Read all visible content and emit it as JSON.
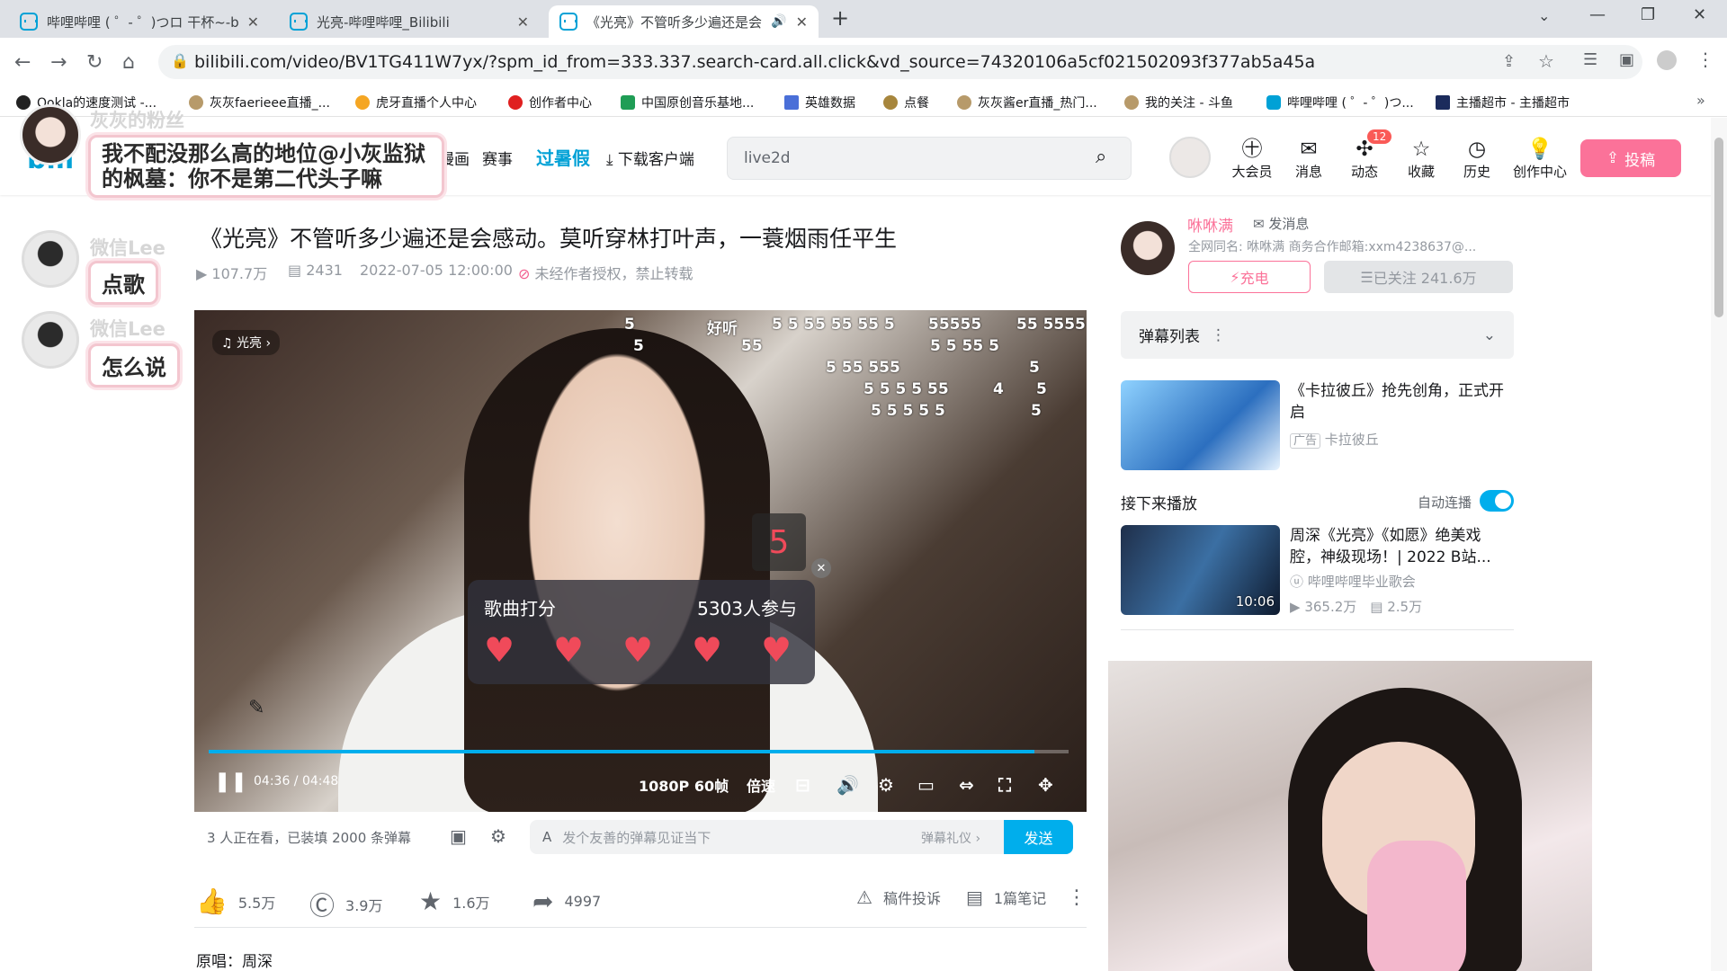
{
  "browser": {
    "tabs": [
      {
        "title": "哔哩哔哩 ( ゜- ゜)つロ 干杯~-bili",
        "active": false
      },
      {
        "title": "光亮-哔哩哔哩_Bilibili",
        "active": false
      },
      {
        "title": "《光亮》不管听多少遍还是会",
        "active": true
      }
    ],
    "url": "bilibili.com/video/BV1TG411W7yx/?spm_id_from=333.337.search-card.all.click&vd_source=74320106a5cf021502093f377ab5a45a",
    "bookmarks": [
      "Ookla的速度测试 -...",
      "灰灰faerieee直播_...",
      "虎牙直播个人中心",
      "创作者中心",
      "中国原创音乐基地...",
      "英雄数据",
      "点餐",
      "灰灰酱er直播_热门...",
      "我的关注 - 斗鱼",
      "哔哩哔哩 ( ゜- ゜)つ...",
      "主播超市 - 主播超市"
    ]
  },
  "header": {
    "nav": [
      "漫画",
      "赛事",
      "过暑假",
      "下载客户端"
    ],
    "search_value": "live2d",
    "icons": [
      {
        "label": "大会员",
        "icon": "vip-icon"
      },
      {
        "label": "消息",
        "icon": "message-icon"
      },
      {
        "label": "动态",
        "icon": "dynamic-icon",
        "badge": "12"
      },
      {
        "label": "收藏",
        "icon": "star-icon"
      },
      {
        "label": "历史",
        "icon": "history-icon"
      },
      {
        "label": "创作中心",
        "icon": "creator-icon"
      }
    ],
    "upload": "投稿"
  },
  "video": {
    "title": "《光亮》不管听多少遍还是会感动。莫听穿林打叶声，一蓑烟雨任平生",
    "views": "107.7万",
    "danmaku_count": "2431",
    "date": "2022-07-05 12:00:00",
    "copyright": "未经作者授权，禁止转载",
    "song_tag": "光亮",
    "danmaku": [
      "好听",
      "5",
      "55",
      "5 5 5",
      "5 55 55 5",
      "55555",
      "55 5555",
      "5 55 555",
      "5 5 5 5 55",
      "5 5 5 5 5",
      "5 5 55 5",
      "5",
      "4",
      "5",
      "5",
      "5"
    ],
    "big_score": "5",
    "score_popup": {
      "title": "歌曲打分",
      "participants": "5303人参与"
    },
    "time_current": "04:36",
    "time_total": "04:48",
    "quality": "1080P 60帧",
    "speed": "倍速",
    "progress": 0.96
  },
  "sendbar": {
    "watching": "3 人正在看，已装填 2000 条弹幕",
    "placeholder": "发个友善的弹幕见证当下",
    "etiquette": "弹幕礼仪",
    "send": "发送"
  },
  "actions": {
    "like": "5.5万",
    "coin": "3.9万",
    "fav": "1.6万",
    "share": "4997",
    "report": "稿件投诉",
    "notes": "1篇笔记"
  },
  "desc": "原唱：周深",
  "uploader": {
    "name": "咻咻满",
    "message": "发消息",
    "desc": "全网同名: 咻咻满 商务合作邮箱:xxm4238637@...",
    "charge": "充电",
    "follow": "已关注 241.6万"
  },
  "sidebar": {
    "danmaku_list": "弹幕列表",
    "ad": {
      "title": "《卡拉彼丘》抢先创角，正式开启",
      "tag": "广告",
      "source": "卡拉彼丘"
    },
    "next_label": "接下来播放",
    "autoplay": "自动连播",
    "rec": {
      "title": "周深《光亮》《如愿》绝美戏腔，神级现场！| 2022 B站...",
      "up": "哔哩哔哩毕业歌会",
      "views": "365.2万",
      "danmaku": "2.5万",
      "duration": "10:06"
    }
  },
  "overlay": {
    "chat": [
      {
        "name": "灰灰的粉丝",
        "msg": "我不配没那么高的地位@小灰监狱的枫墓：你不是第二代头子嘛"
      },
      {
        "name": "微信Lee",
        "msg": "点歌"
      },
      {
        "name": "微信Lee",
        "msg": "怎么说"
      }
    ]
  }
}
